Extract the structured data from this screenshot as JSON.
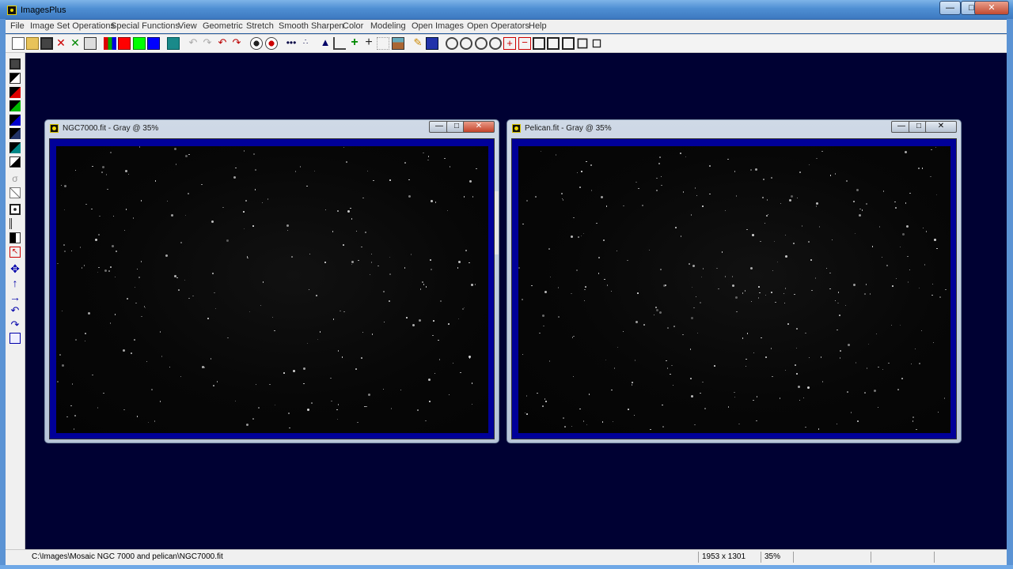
{
  "app": {
    "title": "ImagesPlus"
  },
  "caption": {
    "minimize": "—",
    "maximize": "□",
    "close": "✕"
  },
  "menu": [
    "File",
    "Image Set Operations",
    "Special Functions",
    "View",
    "Geometric",
    "Stretch",
    "Smooth Sharpen",
    "Color",
    "Modeling",
    "Open Images",
    "Open Operators",
    "Help"
  ],
  "windows": [
    {
      "title": "NGC7000.fit - Gray @ 35%"
    },
    {
      "title": "Pelican.fit - Gray @ 35%"
    }
  ],
  "status": {
    "path": "C:\\Images\\Mosaic NGC 7000 and pelican\\NGC7000.fit",
    "dimensions": "1953 x 1301",
    "zoom": "35%"
  },
  "colors": {
    "workspace": "#000133",
    "image_border": "#000099"
  },
  "toolbar_icons": [
    "new-file-icon",
    "open-folder-icon",
    "save-icon",
    "close-red-icon",
    "close-green-icon",
    "calculator-icon",
    "rgb-channels-icon",
    "red-channel-icon",
    "green-channel-icon",
    "blue-channel-icon",
    "color-grid-icon",
    "undo-icon",
    "redo-icon",
    "undo-red-icon",
    "redo-red-icon",
    "circle-dark-icon",
    "circle-red-icon",
    "dots-line-icon",
    "dots-p-icon",
    "triangle-icon",
    "axis-l-icon",
    "plus-green-icon",
    "crosshair-icon",
    "grid-icon",
    "image-icon",
    "pencil-icon",
    "table-icon",
    "zoom-in-icon",
    "zoom-out-icon",
    "zoom-fit-icon",
    "zoom-reset-icon",
    "plus-box-icon",
    "minus-box-icon",
    "square-1-icon",
    "square-2-icon",
    "square-3-icon",
    "square-4-icon",
    "square-5-icon"
  ]
}
